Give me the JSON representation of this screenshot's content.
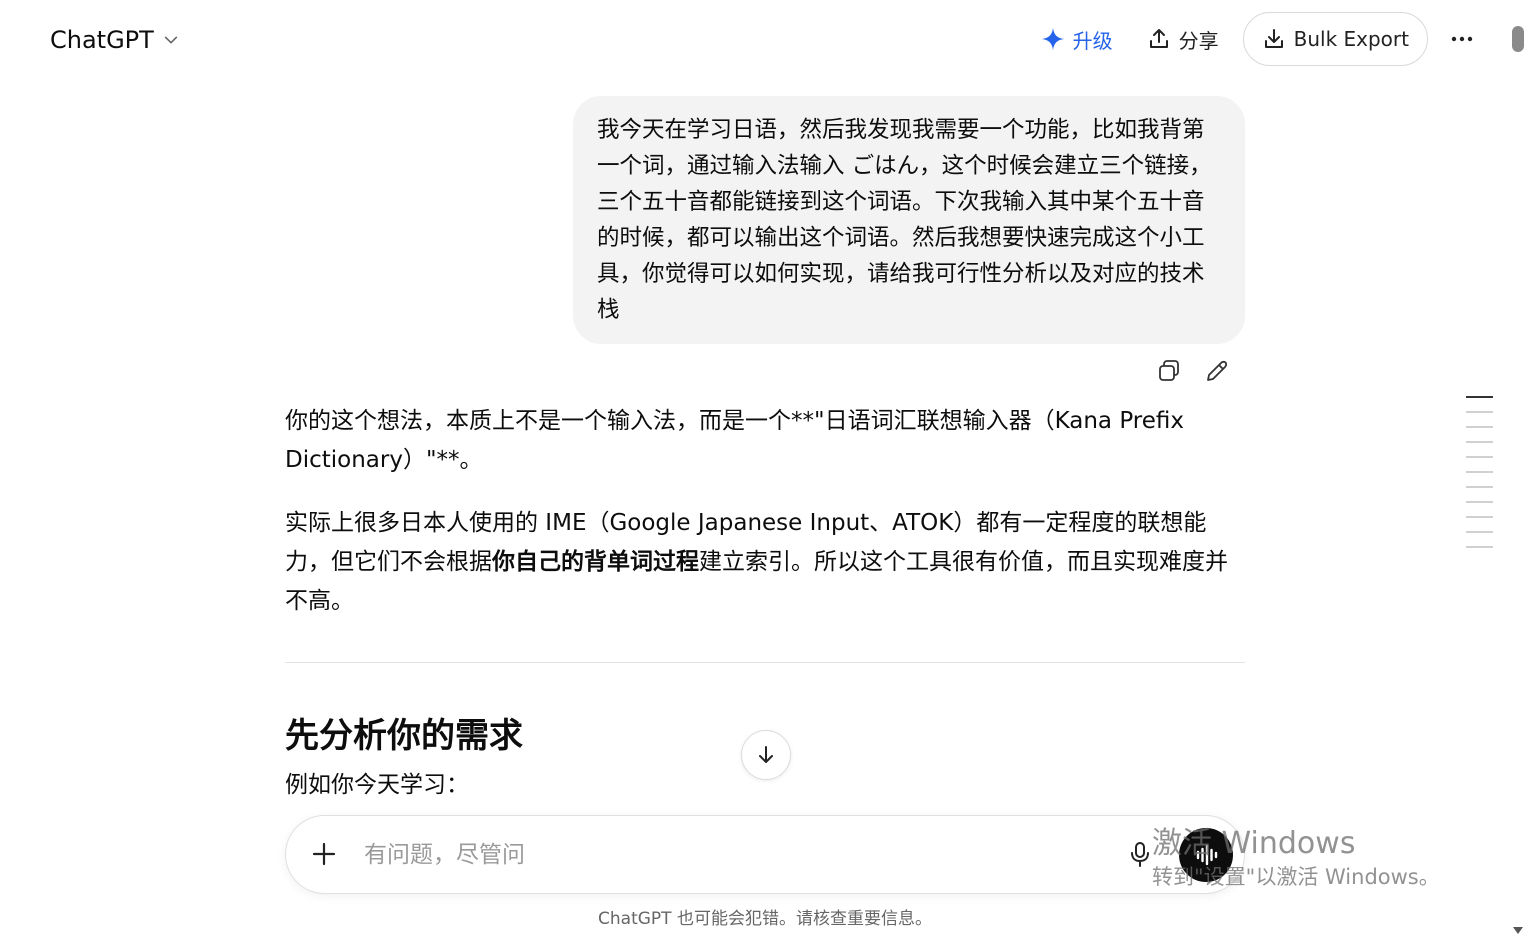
{
  "header": {
    "model_name": "ChatGPT",
    "upgrade_label": "升级",
    "share_label": "分享",
    "export_label": "Bulk Export",
    "more_label": "···"
  },
  "colors": {
    "accent": "#2563eb",
    "bubble_bg": "#f3f3f3",
    "text": "#0d0d0d"
  },
  "user_message": "我今天在学习日语，然后我发现我需要一个功能，比如我背第一个词，通过输入法输入 ごはん，这个时候会建立三个链接，三个五十音都能链接到这个词语。下次我输入其中某个五十音的时候，都可以输出这个词语。然后我想要快速完成这个小工具，你觉得可以如何实现，请给我可行性分析以及对应的技术栈",
  "answer": {
    "p1": "你的这个想法，本质上不是一个输入法，而是一个**\"日语词汇联想输入器（Kana Prefix Dictionary）\"**。",
    "p2_before": "实际上很多日本人使用的 IME（Google Japanese Input、ATOK）都有一定程度的联想能力，但它们不会根据",
    "p2_bold": "你自己的背单词过程",
    "p2_after": "建立索引。所以这个工具很有价值，而且实现难度并不高。",
    "heading": "先分析你的需求",
    "sub": "例如你今天学习："
  },
  "composer": {
    "placeholder": "有问题，尽管问"
  },
  "disclaimer": "ChatGPT 也可能会犯错。请核查重要信息。",
  "watermark": {
    "title": "激活 Windows",
    "subtitle": "转到\"设置\"以激活 Windows。"
  },
  "icons": [
    "chevron-down-icon",
    "sparkle-icon",
    "share-icon",
    "download-icon",
    "more-icon",
    "copy-icon",
    "edit-icon",
    "arrow-down-icon",
    "plus-icon",
    "mic-icon",
    "voice-icon"
  ]
}
